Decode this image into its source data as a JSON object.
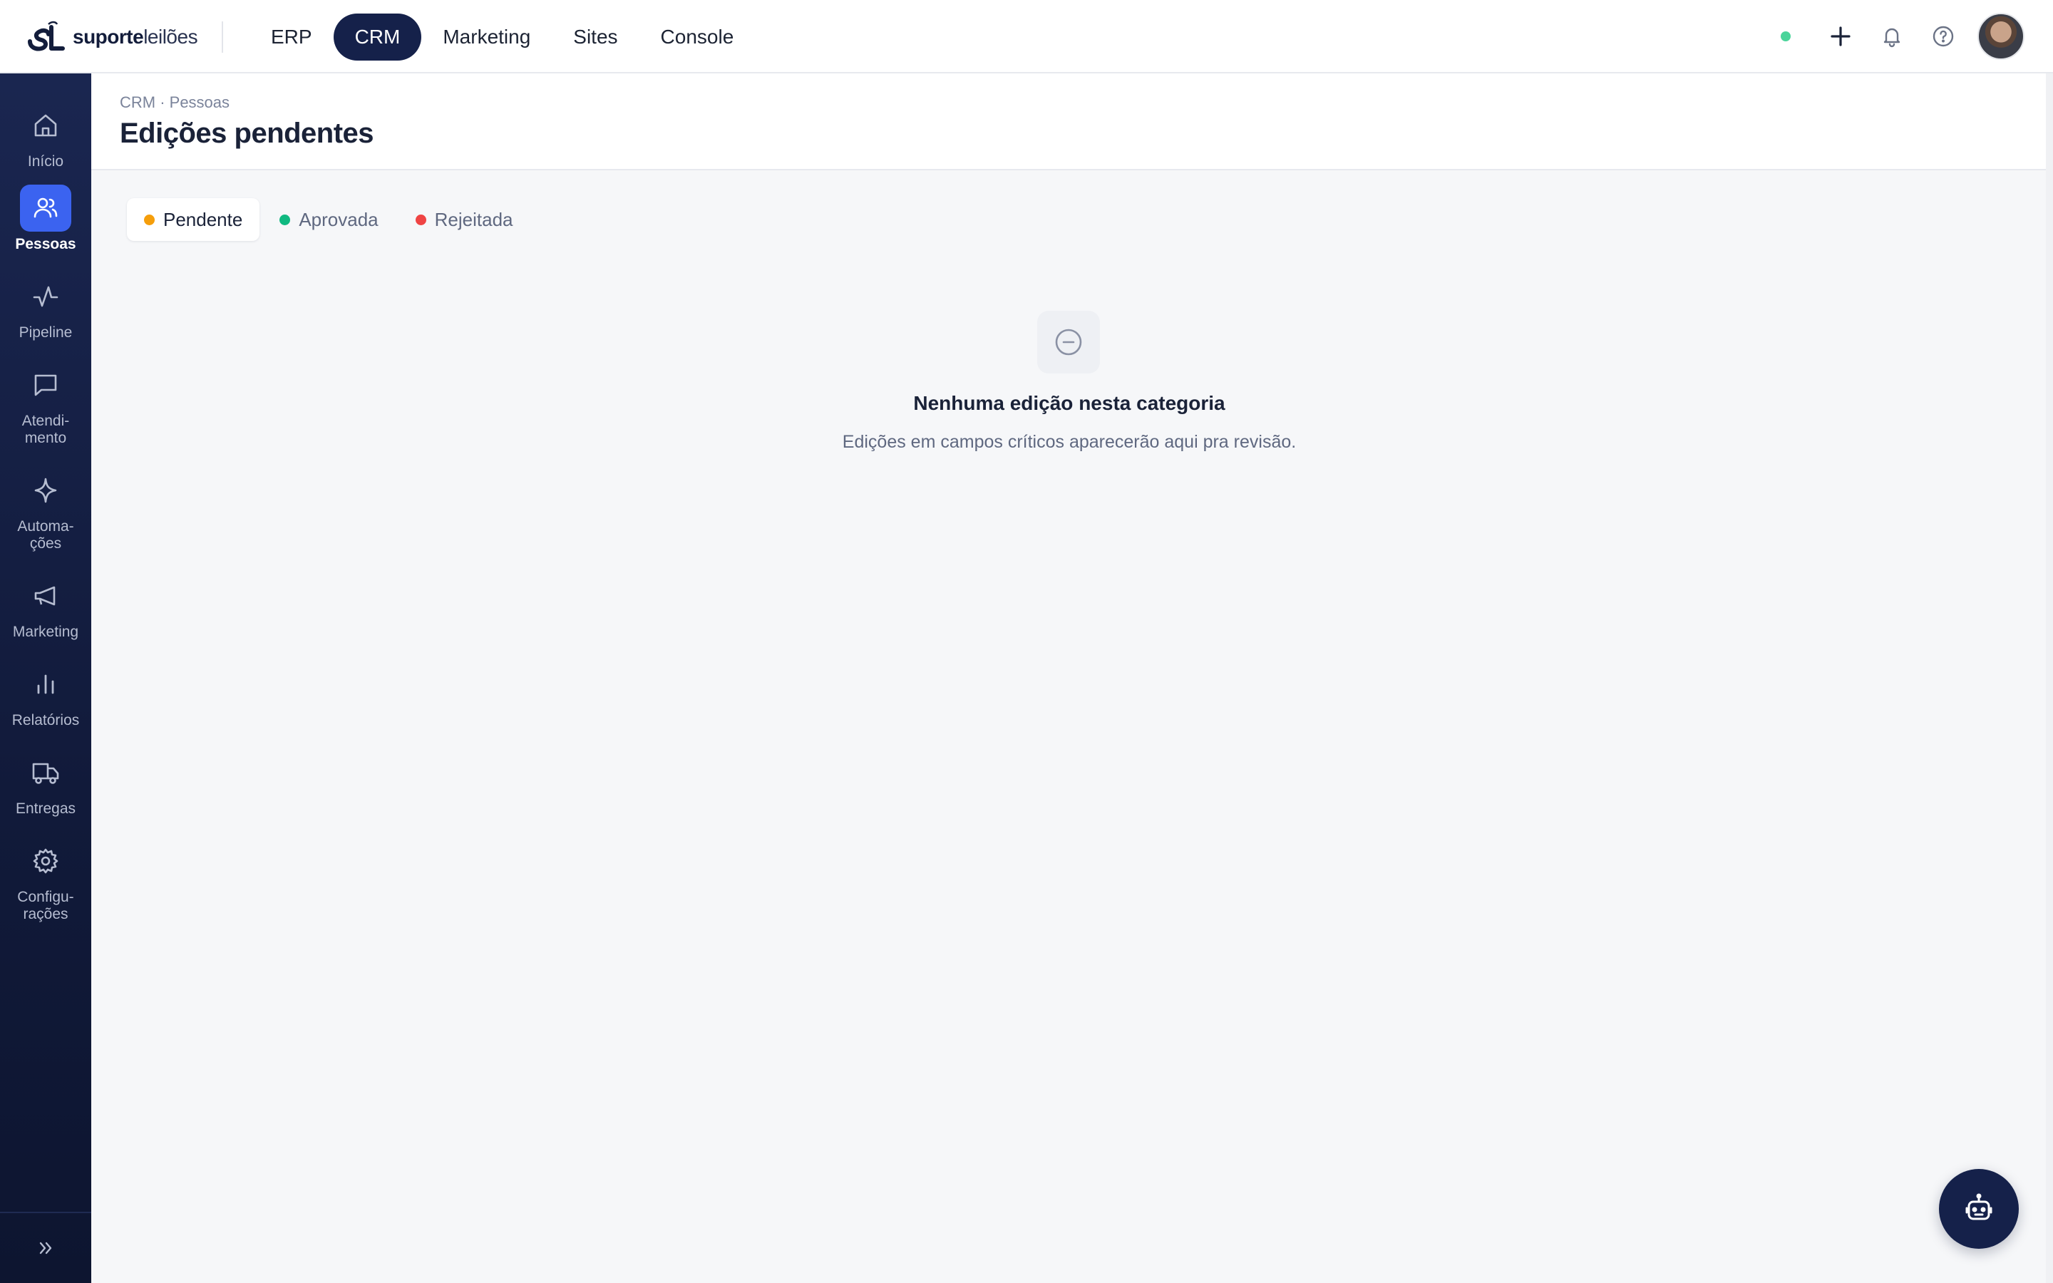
{
  "brand": {
    "name_bold": "suporte",
    "name_light": "leilões"
  },
  "top_nav": {
    "items": [
      {
        "label": "ERP",
        "active": false
      },
      {
        "label": "CRM",
        "active": true
      },
      {
        "label": "Marketing",
        "active": false
      },
      {
        "label": "Sites",
        "active": false
      },
      {
        "label": "Console",
        "active": false
      }
    ]
  },
  "top_actions": {
    "status_color": "#4ad49a",
    "icons": [
      "plus-icon",
      "bell-icon",
      "help-circle-icon"
    ]
  },
  "sidebar": {
    "items": [
      {
        "label": "Início",
        "icon": "home-icon",
        "active": false
      },
      {
        "label": "Pessoas",
        "icon": "users-icon",
        "active": true
      },
      {
        "label": "Pipeline",
        "icon": "activity-icon",
        "active": false
      },
      {
        "label": "Atendi-\nmento",
        "icon": "message-square-icon",
        "active": false
      },
      {
        "label": "Automa-\nções",
        "icon": "sparkle-icon",
        "active": false
      },
      {
        "label": "Marketing",
        "icon": "megaphone-icon",
        "active": false
      },
      {
        "label": "Relatórios",
        "icon": "bar-chart-icon",
        "active": false
      },
      {
        "label": "Entregas",
        "icon": "truck-icon",
        "active": false
      },
      {
        "label": "Configu-\nrações",
        "icon": "gear-icon",
        "active": false
      }
    ],
    "collapse_icon": "chevrons-right-icon"
  },
  "header": {
    "breadcrumb": "CRM · Pessoas",
    "title": "Edições pendentes"
  },
  "tabs": [
    {
      "label": "Pendente",
      "color": "#f59e0b",
      "active": true
    },
    {
      "label": "Aprovada",
      "color": "#10b981",
      "active": false
    },
    {
      "label": "Rejeitada",
      "color": "#ef4444",
      "active": false
    }
  ],
  "empty_state": {
    "icon": "minus-circle-icon",
    "title": "Nenhuma edição nesta categoria",
    "subtitle": "Edições em campos críticos aparecerão aqui pra revisão."
  },
  "fab": {
    "icon": "bot-icon"
  },
  "colors": {
    "accent": "#3b63f0",
    "navy": "#15214a"
  }
}
